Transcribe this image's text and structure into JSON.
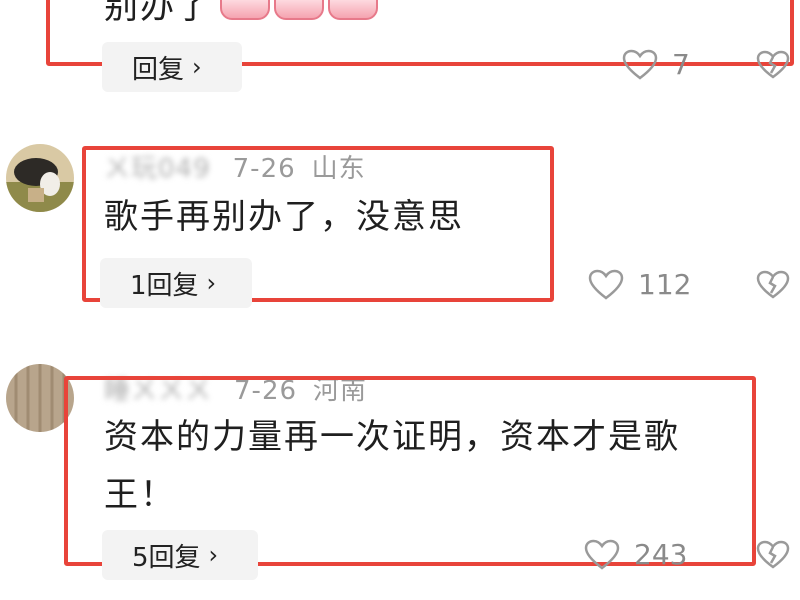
{
  "comments": [
    {
      "text": "别办了",
      "reply_label": "回复",
      "likes": "7"
    },
    {
      "username": "ㄨ玩049",
      "date": "7-26",
      "location": "山东",
      "text": "歌手再别办了，没意思",
      "reply_label": "1回复",
      "likes": "112"
    },
    {
      "username": "睡ㄨㄨㄨ",
      "date": "7-26",
      "location": "河南",
      "text_line1": "资本的力量再一次证明，资本才是歌",
      "text_line2": "王！",
      "reply_label": "5回复",
      "likes": "243"
    }
  ],
  "icons": {
    "like": "heart-outline-icon",
    "dislike": "broken-heart-icon",
    "chevron": "chevron-right-icon"
  },
  "colors": {
    "highlight_border": "#e8443a",
    "meta_text": "#9a9a9a",
    "reply_bg": "#f3f3f3"
  }
}
